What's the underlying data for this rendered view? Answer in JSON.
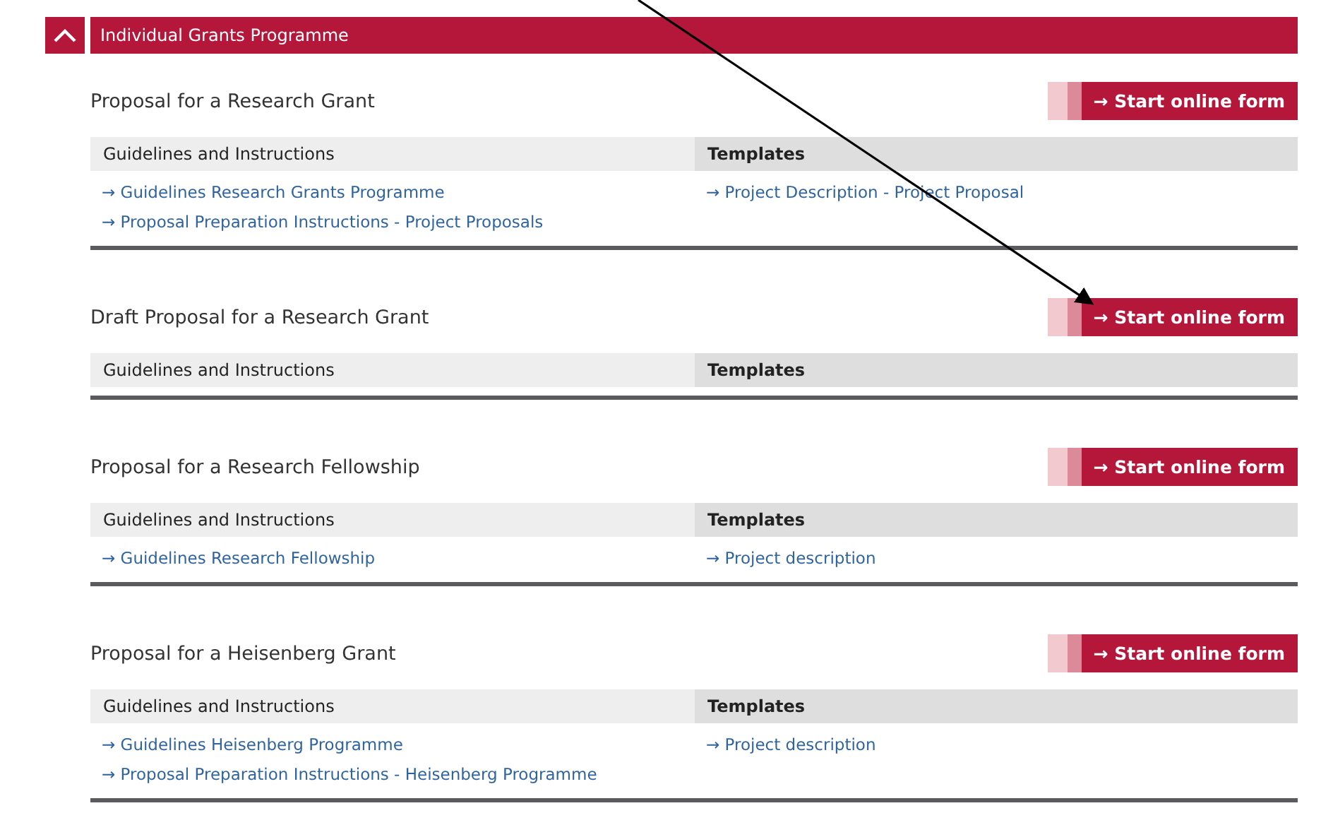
{
  "panel": {
    "title": "Individual Grants Programme",
    "expanded": true
  },
  "sections": [
    {
      "title": "Proposal for a Research Grant",
      "button": "→ Start online form",
      "guidelines_heading": "Guidelines and Instructions",
      "templates_heading": "Templates",
      "guidelines": [
        "→ Guidelines Research Grants Programme",
        "→ Proposal Preparation Instructions - Project Proposals"
      ],
      "templates": [
        "→ Project Description - Project Proposal"
      ]
    },
    {
      "title": "Draft Proposal for a Research Grant",
      "button": "→ Start online form",
      "guidelines_heading": "Guidelines and Instructions",
      "templates_heading": "Templates"
    },
    {
      "title": "Proposal for a Research Fellowship",
      "button": "→ Start online form",
      "guidelines_heading": "Guidelines and Instructions",
      "templates_heading": "Templates",
      "guidelines": [
        "→ Guidelines Research Fellowship"
      ],
      "templates": [
        "→ Project description"
      ]
    },
    {
      "title": "Proposal for a Heisenberg Grant",
      "button": "→ Start online form",
      "guidelines_heading": "Guidelines and Instructions",
      "templates_heading": "Templates",
      "guidelines": [
        "→ Guidelines Heisenberg Programme",
        "→ Proposal Preparation Instructions - Heisenberg Programme"
      ],
      "templates": [
        "→ Project description"
      ]
    }
  ]
}
